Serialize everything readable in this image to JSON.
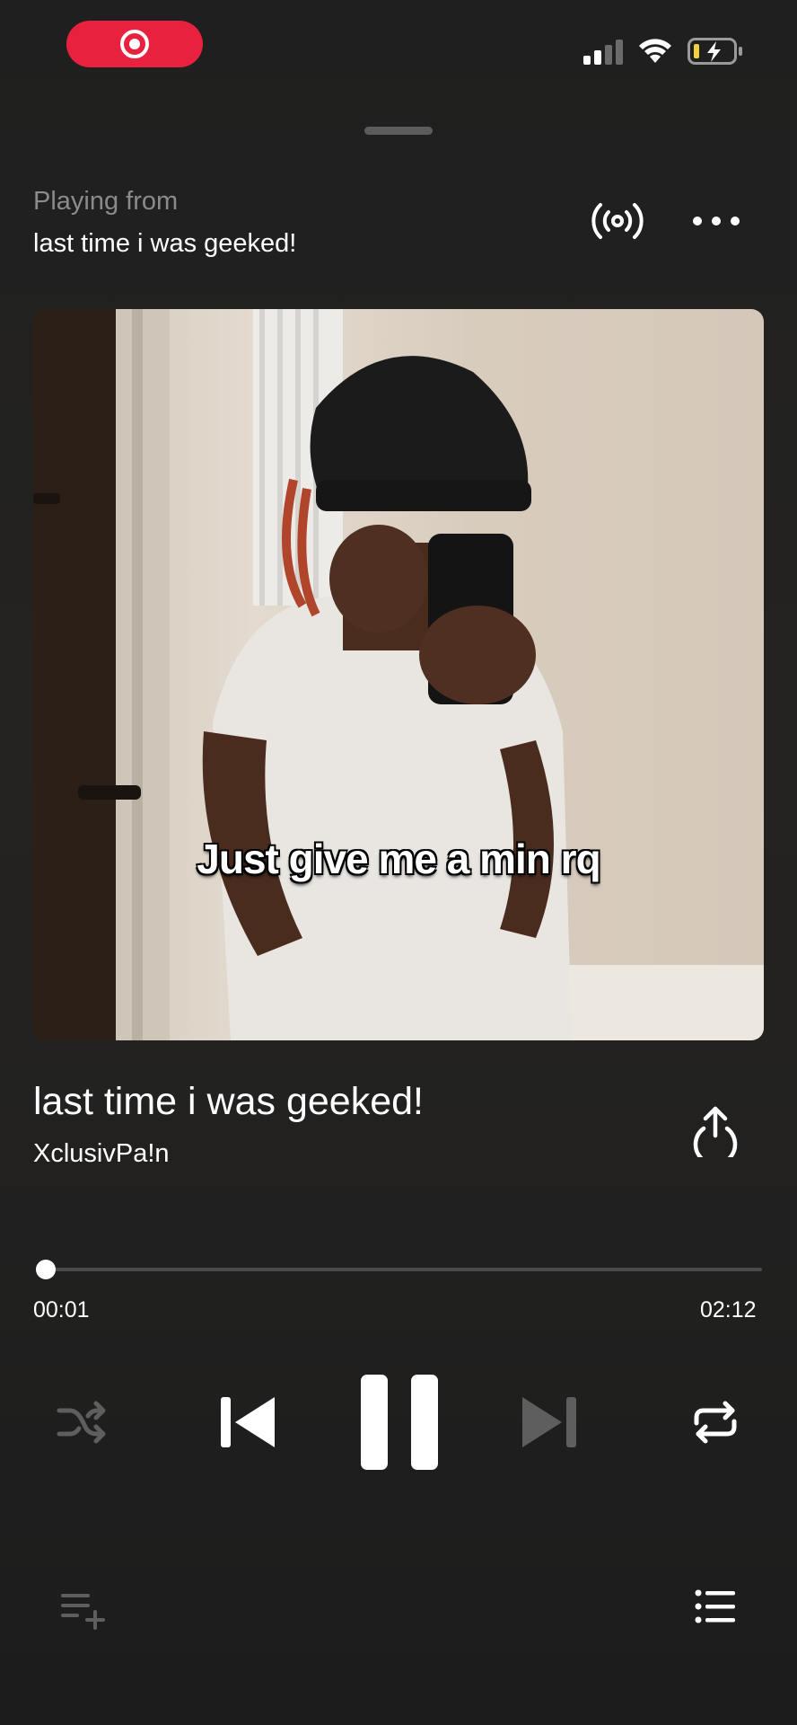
{
  "status_bar": {
    "recording": true,
    "battery_charging": true,
    "accent_color": "#e8213f"
  },
  "header": {
    "playing_from_label": "Playing from",
    "context_title": "last time i was geeked!"
  },
  "artwork": {
    "caption": "Just give me a min rq"
  },
  "track": {
    "title": "last time i was geeked!",
    "artist": "XclusivPa!n"
  },
  "progress": {
    "elapsed": "00:01",
    "total": "02:12",
    "fraction": 0.008
  },
  "controls": {
    "shuffle_enabled": false,
    "next_enabled": false,
    "repeat_enabled": true,
    "state": "playing"
  },
  "icons": {
    "record": "record-icon",
    "signal": "cellular-signal-icon",
    "wifi": "wifi-icon",
    "battery": "battery-charging-icon",
    "broadcast": "broadcast-icon",
    "more": "more-horizontal-icon",
    "share": "share-icon",
    "shuffle": "shuffle-icon",
    "previous": "skip-previous-icon",
    "pause": "pause-icon",
    "next": "skip-next-icon",
    "repeat": "repeat-icon",
    "add_to_queue": "add-to-playlist-icon",
    "queue": "queue-list-icon"
  }
}
